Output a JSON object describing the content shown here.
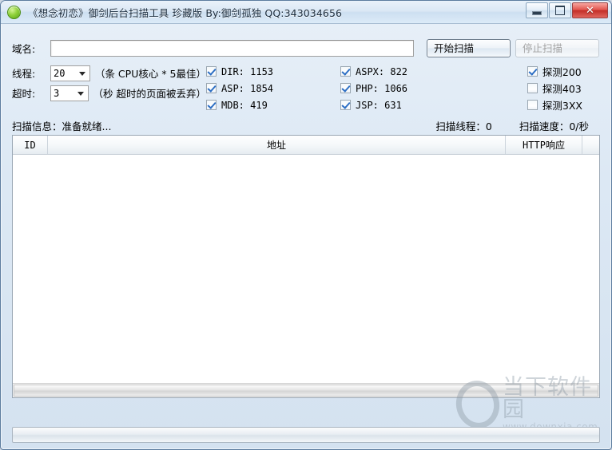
{
  "window": {
    "title": "《想念初恋》御剑后台扫描工具 珍藏版 By:御剑孤独 QQ:343034656",
    "icon": "green-circle-icon",
    "minimize_label": "",
    "maximize_label": "",
    "close_label": "✕"
  },
  "form": {
    "domain_label": "域名:",
    "domain_value": "",
    "domain_placeholder": "",
    "start_button": "开始扫描",
    "stop_button": "停止扫描",
    "thread_label": "线程:",
    "thread_value": "20",
    "thread_hint": "（条 CPU核心 * 5最佳）",
    "timeout_label": "超时:",
    "timeout_value": "3",
    "timeout_hint": "（秒 超时的页面被丢弃）"
  },
  "dict_options": {
    "col1": [
      {
        "label": "DIR: 1153",
        "checked": true
      },
      {
        "label": "ASP: 1854",
        "checked": true
      },
      {
        "label": "MDB: 419",
        "checked": true
      }
    ],
    "col2": [
      {
        "label": "ASPX: 822",
        "checked": true
      },
      {
        "label": "PHP: 1066",
        "checked": true
      },
      {
        "label": "JSP: 631",
        "checked": true
      }
    ],
    "col3": [
      {
        "label": "探测200",
        "checked": true
      },
      {
        "label": "探测403",
        "checked": false
      },
      {
        "label": "探测3XX",
        "checked": false
      }
    ]
  },
  "status": {
    "scan_info": "扫描信息：准备就绪...",
    "scan_threads": "扫描线程：0",
    "scan_speed": "扫描速度：0/秒"
  },
  "table": {
    "columns": [
      "ID",
      "地址",
      "HTTP响应"
    ],
    "rows": []
  },
  "watermark": {
    "brand": "当下软件园",
    "url": "www.downxia.com"
  },
  "colors": {
    "titlebar_text": "#1a2b3c",
    "close_button": "#c32f28",
    "accent_check": "#2d6fc4",
    "window_border": "#5c7c9e"
  }
}
